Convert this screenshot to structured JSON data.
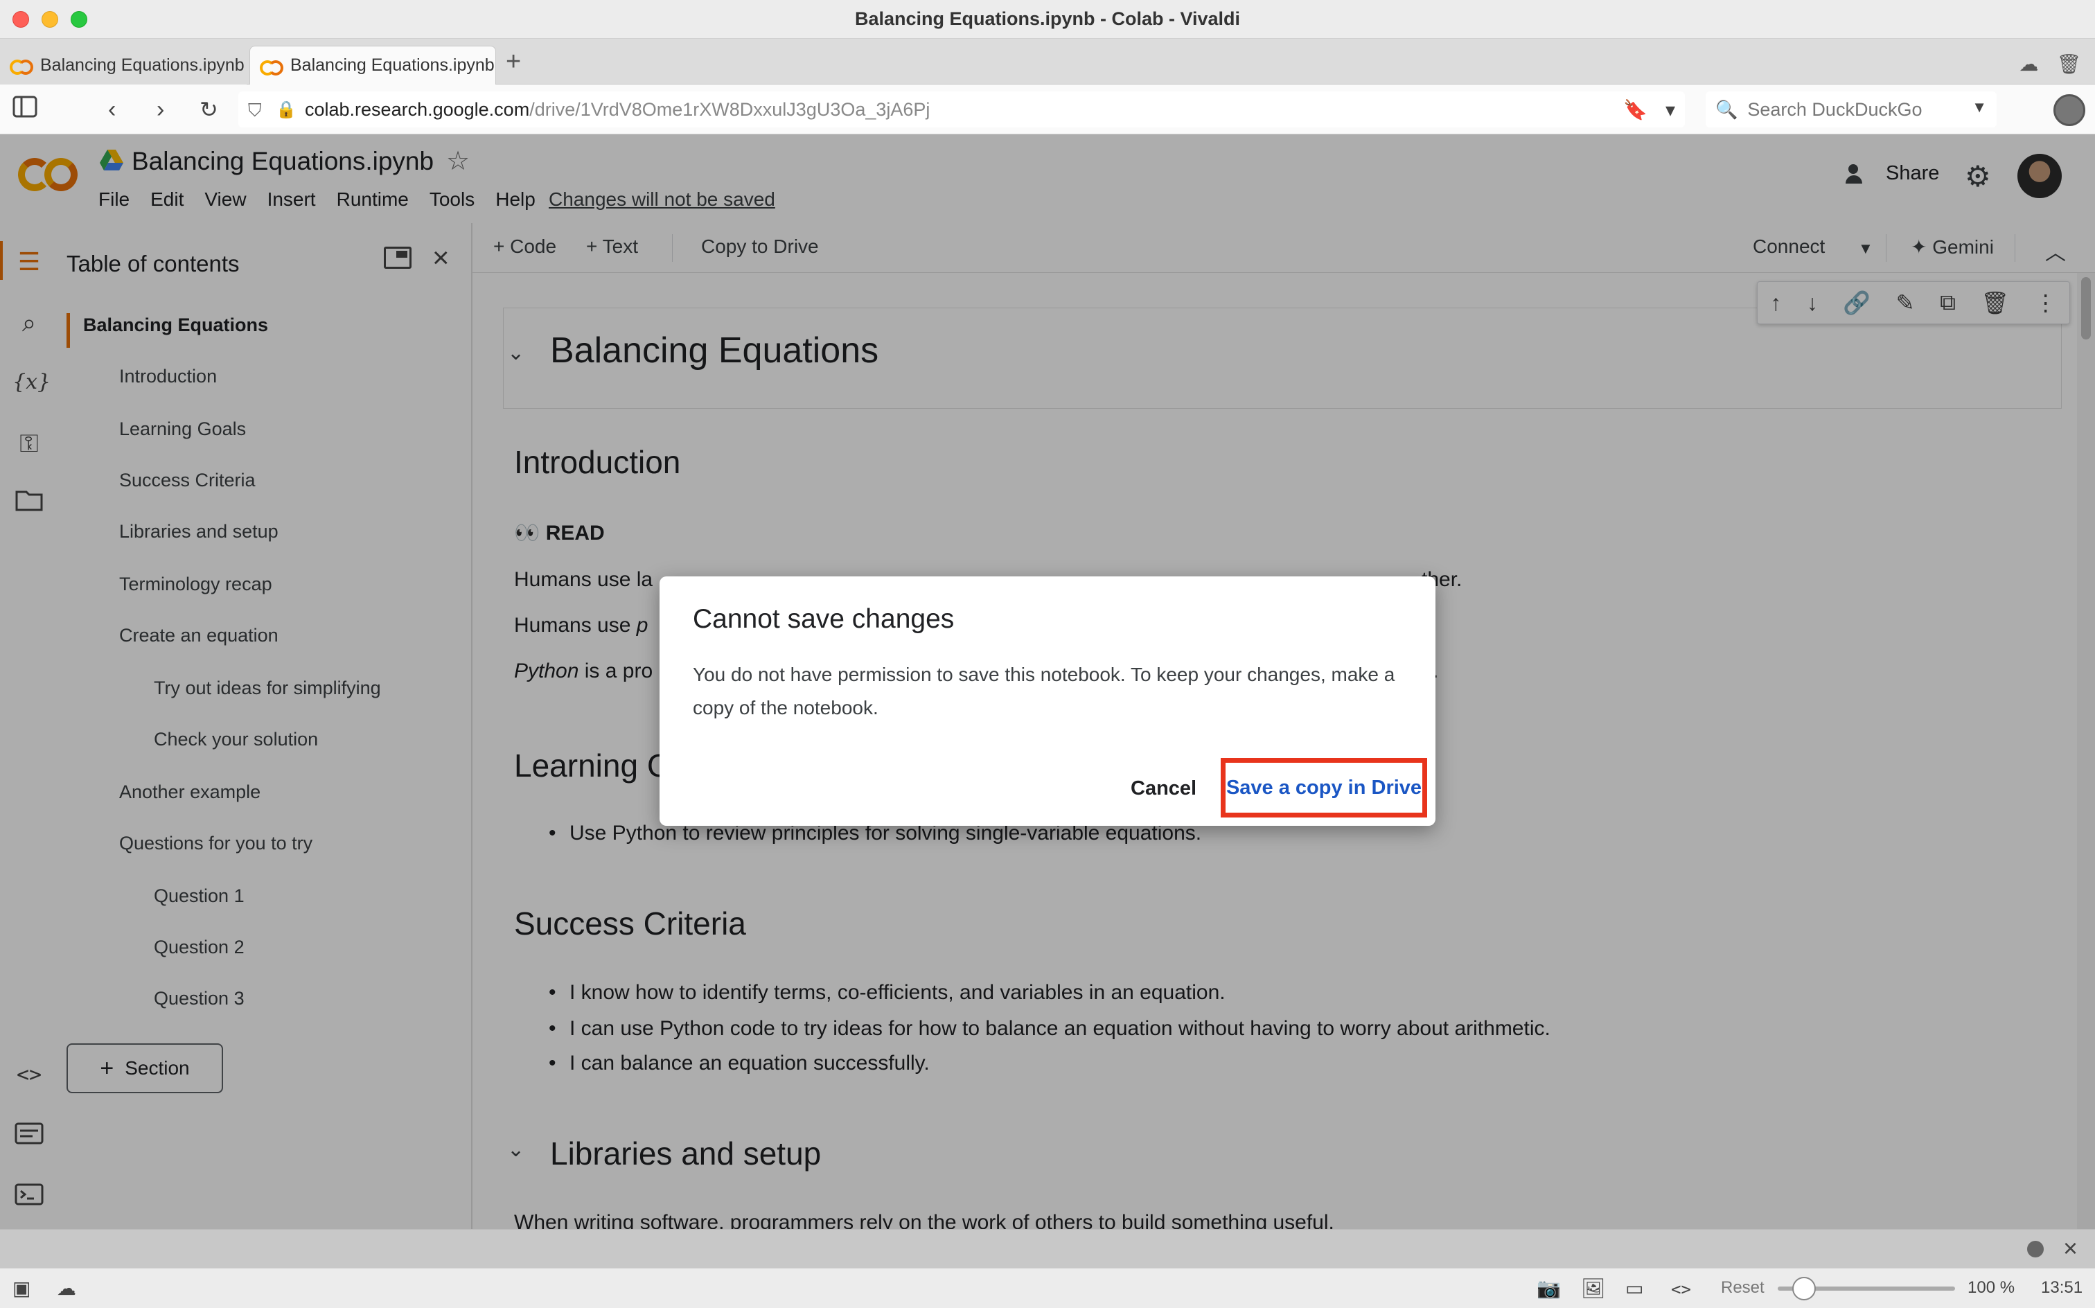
{
  "window": {
    "title": "Balancing Equations.ipynb - Colab - Vivaldi"
  },
  "tabs": [
    {
      "label": "Balancing Equations.ipynb"
    },
    {
      "label": "Balancing Equations.ipynb"
    }
  ],
  "address": {
    "host": "colab.research.google.com",
    "path": "/drive/1VrdV8Ome1rXW8DxxulJ3gU3Oa_3jA6Pj",
    "search_placeholder": "Search DuckDuckGo"
  },
  "colab": {
    "notebook_title": "Balancing Equations.ipynb",
    "menu": [
      "File",
      "Edit",
      "View",
      "Insert",
      "Runtime",
      "Tools",
      "Help"
    ],
    "changes_link": "Changes will not be saved",
    "share_label": "Share"
  },
  "toc": {
    "title": "Table of contents",
    "items": [
      {
        "label": "Balancing Equations"
      },
      {
        "label": "Introduction"
      },
      {
        "label": "Learning Goals"
      },
      {
        "label": "Success Criteria"
      },
      {
        "label": "Libraries and setup"
      },
      {
        "label": "Terminology recap"
      },
      {
        "label": "Create an equation"
      },
      {
        "label": "Try out ideas for simplifying"
      },
      {
        "label": "Check your solution"
      },
      {
        "label": "Another example"
      },
      {
        "label": "Questions for you to try"
      },
      {
        "label": "Question 1"
      },
      {
        "label": "Question 2"
      },
      {
        "label": "Question 3"
      }
    ],
    "section_button": "Section"
  },
  "toolbar": {
    "code": "Code",
    "text": "Text",
    "copy_to_drive": "Copy to Drive",
    "connect": "Connect",
    "gemini": "Gemini"
  },
  "notebook": {
    "h1": "Balancing Equations",
    "intro_heading": "Introduction",
    "read_label": "READ",
    "line1_start": "Humans use la",
    "line1_end": "ther.",
    "line2_start": "Humans use",
    "line2_italic": "p",
    "line3_italic": "Python",
    "line3_rest": "is a pro",
    "line3_end": ".",
    "learning_heading_partial": "Learning G",
    "learning_bullet": "Use Python to review principles for solving single-variable equations.",
    "success_heading": "Success Criteria",
    "success_bullets": [
      "I know how to identify terms, co-efficients, and variables in an equation.",
      "I can use Python code to try ideas for how to balance an equation without having to worry about arithmetic.",
      "I can balance an equation successfully."
    ],
    "libraries_heading": "Libraries and setup",
    "libraries_para": "When writing software, programmers rely on the work of others to build something useful."
  },
  "dialog": {
    "title": "Cannot save changes",
    "body": "You do not have permission to save this notebook. To keep your changes, make a copy of the notebook.",
    "cancel": "Cancel",
    "save_copy": "Save a copy in Drive"
  },
  "statusbar": {
    "reset": "Reset",
    "zoom": "100 %",
    "time": "13:51",
    "zoom_fraction": 0.15
  },
  "colors": {
    "colab_orange": "#f9ab00",
    "highlight_red": "#e8341c",
    "link_blue": "#1a56c4"
  }
}
